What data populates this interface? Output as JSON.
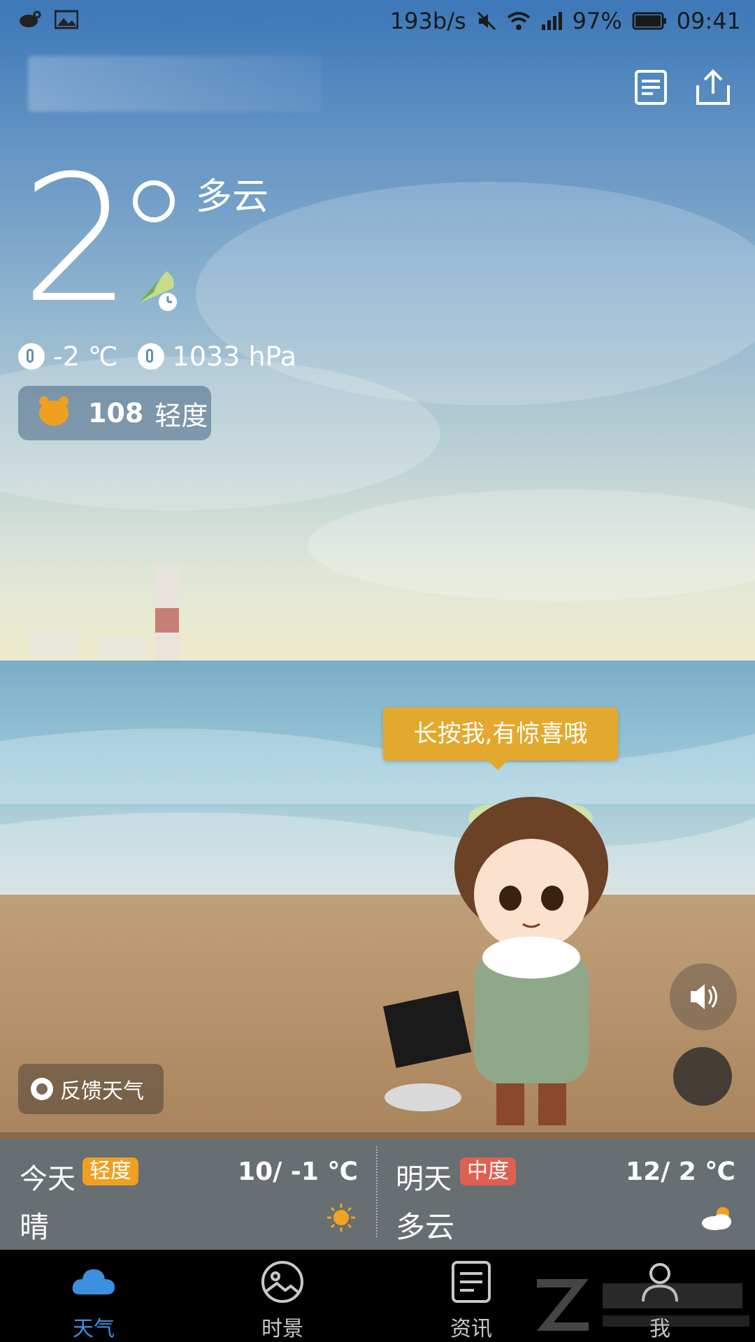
{
  "status_bar": {
    "net_speed": "193b/s",
    "battery": "97%",
    "time": "09:41",
    "icons": [
      "mute-icon",
      "wifi-icon",
      "signal-icon",
      "battery-icon"
    ]
  },
  "header": {
    "city_name_blurred": true,
    "actions": [
      {
        "name": "list-icon"
      },
      {
        "name": "share-icon"
      }
    ]
  },
  "current": {
    "temperature": "2",
    "condition": "多云",
    "feels_like": "-2 ℃",
    "pressure": "1033 hPa",
    "aqi_value": "108",
    "aqi_level": "轻度"
  },
  "mascot": {
    "bubble_text": "长按我,有惊喜哦"
  },
  "feedback": {
    "label": "反馈天气"
  },
  "forecast": [
    {
      "day": "今天",
      "aqi_level": "轻度",
      "aqi_color": "#f0a020",
      "temp": "10/ -1 ℃",
      "condition": "晴",
      "icon": "sun-icon"
    },
    {
      "day": "明天",
      "aqi_level": "中度",
      "aqi_color": "#e06050",
      "temp": "12/ 2 ℃",
      "condition": "多云",
      "icon": "partly-cloudy-icon"
    }
  ],
  "nav": [
    {
      "label": "天气",
      "icon": "cloud-icon",
      "active": true
    },
    {
      "label": "时景",
      "icon": "photo-icon",
      "active": false
    },
    {
      "label": "资讯",
      "icon": "news-icon",
      "active": false
    },
    {
      "label": "我",
      "icon": "user-icon",
      "active": false
    }
  ],
  "colors": {
    "accent": "#3d8fe0",
    "bubble": "#e2a92c",
    "aqi_light": "#f0a020",
    "aqi_moderate": "#e06050"
  }
}
